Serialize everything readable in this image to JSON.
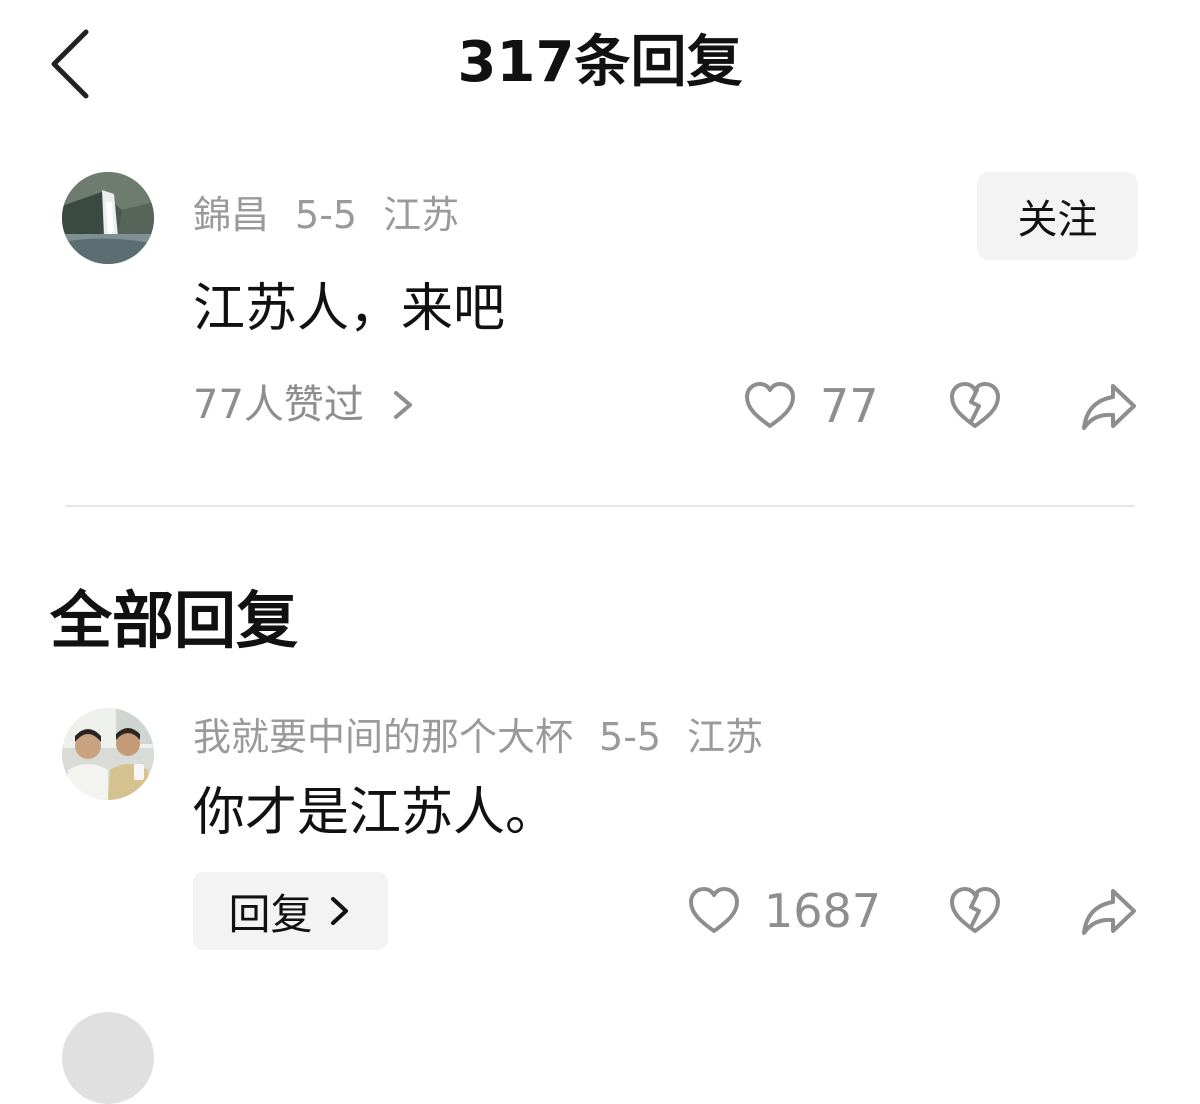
{
  "header": {
    "title": "317条回复"
  },
  "main_comment": {
    "username": "錦昌",
    "date": "5-5",
    "location": "江苏",
    "follow_label": "关注",
    "text": "江苏人，来吧",
    "likers_text": "77人赞过",
    "like_count": "77"
  },
  "replies_section": {
    "title": "全部回复"
  },
  "replies": [
    {
      "username": "我就要中间的那个大杯",
      "date": "5-5",
      "location": "江苏",
      "text": "你才是江苏人。",
      "reply_label": "回复",
      "like_count": "1687"
    }
  ],
  "icons": {
    "back": "chevron-left-icon",
    "like": "heart-outline-icon",
    "dislike": "broken-heart-icon",
    "share": "share-arrow-icon",
    "chevron": "chevron-right-icon"
  },
  "colors": {
    "text_primary": "#111111",
    "text_secondary": "#9a9a9a",
    "button_bg": "#f3f3f3",
    "divider": "#e6e6e6"
  }
}
